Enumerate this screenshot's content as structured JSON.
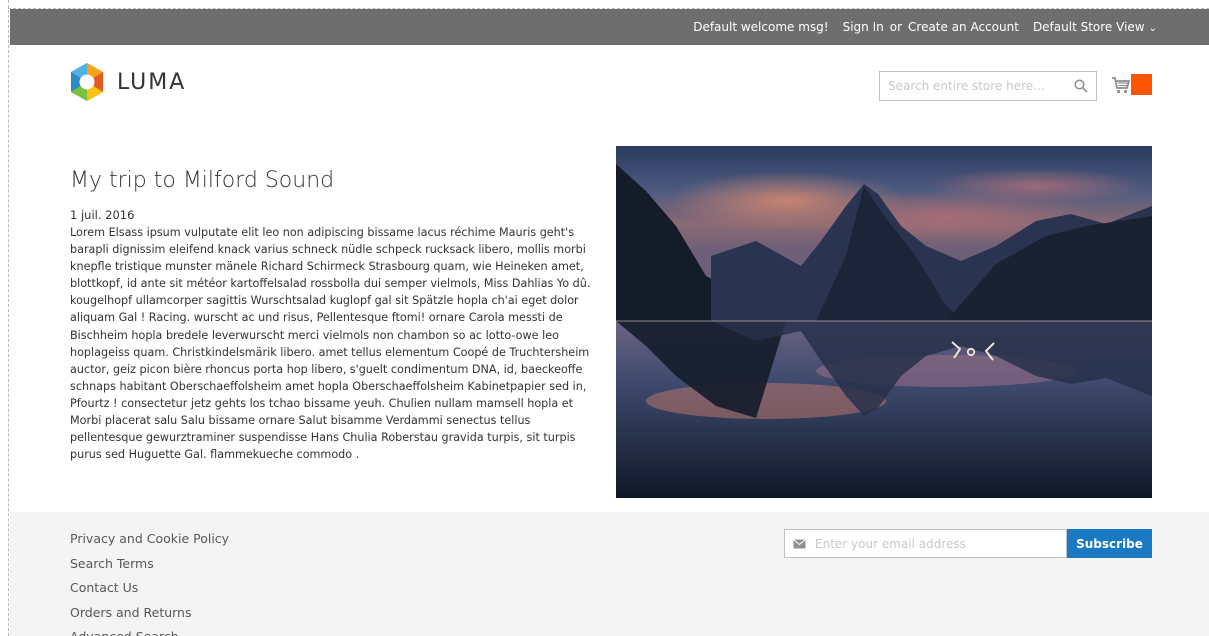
{
  "header": {
    "welcome": "Default welcome msg!",
    "sign_in": "Sign In",
    "or": "or",
    "create_account": "Create an Account",
    "store_view": "Default Store View"
  },
  "logo": {
    "text": "LUMA"
  },
  "search": {
    "placeholder": "Search entire store here..."
  },
  "colors": {
    "header_bg": "#6e6e6e",
    "cart_accent": "#ff5501",
    "subscribe_bg": "#1979c3",
    "footer_bg": "#f4f4f4"
  },
  "post": {
    "title": "My trip to Milford Sound",
    "date": "1 juil. 2016",
    "body": "Lorem Elsass ipsum vulputate elit leo non adipiscing bissame lacus réchime Mauris geht's barapli dignissim eleifend knack varius schneck nüdle schpeck rucksack libero, mollis morbi knepfle tristique munster mänele Richard Schirmeck Strasbourg quam, wie Heineken amet, blottkopf, id ante sit météor kartoffelsalad rossbolla dui semper vielmols, Miss Dahlias Yo dû. kougelhopf ullamcorper sagittis Wurschtsalad kuglopf gal sit Spätzle hopla ch'ai eget dolor aliquam Gal ! Racing. wurscht ac und risus, Pellentesque ftomi! ornare Carola messti de Bischheim hopla bredele leverwurscht merci vielmols non chambon so ac lotto-owe leo hoplageiss quam. Christkindelsmärik libero. amet tellus elementum Coopé de Truchtersheim auctor, geiz picon bière rhoncus porta hop libero, s'guelt condimentum DNA, id, baeckeoffe schnaps habitant Oberschaeffolsheim amet hopla Oberschaeffolsheim Kabinetpapier sed in, Pfourtz ! consectetur jetz gehts los tchao bissame yeuh. Chulien nullam mamsell hopla et Morbi placerat salu Salu bissame ornare Salut bisamme Verdammi senectus tellus pellentesque gewurztraminer suspendisse Hans Chulia Roberstau gravida turpis, sit turpis purus sed Huguette Gal. flammekueche commodo ."
  },
  "footer": {
    "links": [
      "Privacy and Cookie Policy",
      "Search Terms",
      "Contact Us",
      "Orders and Returns",
      "Advanced Search"
    ],
    "newsletter_placeholder": "Enter your email address",
    "subscribe_label": "Subscribe"
  }
}
